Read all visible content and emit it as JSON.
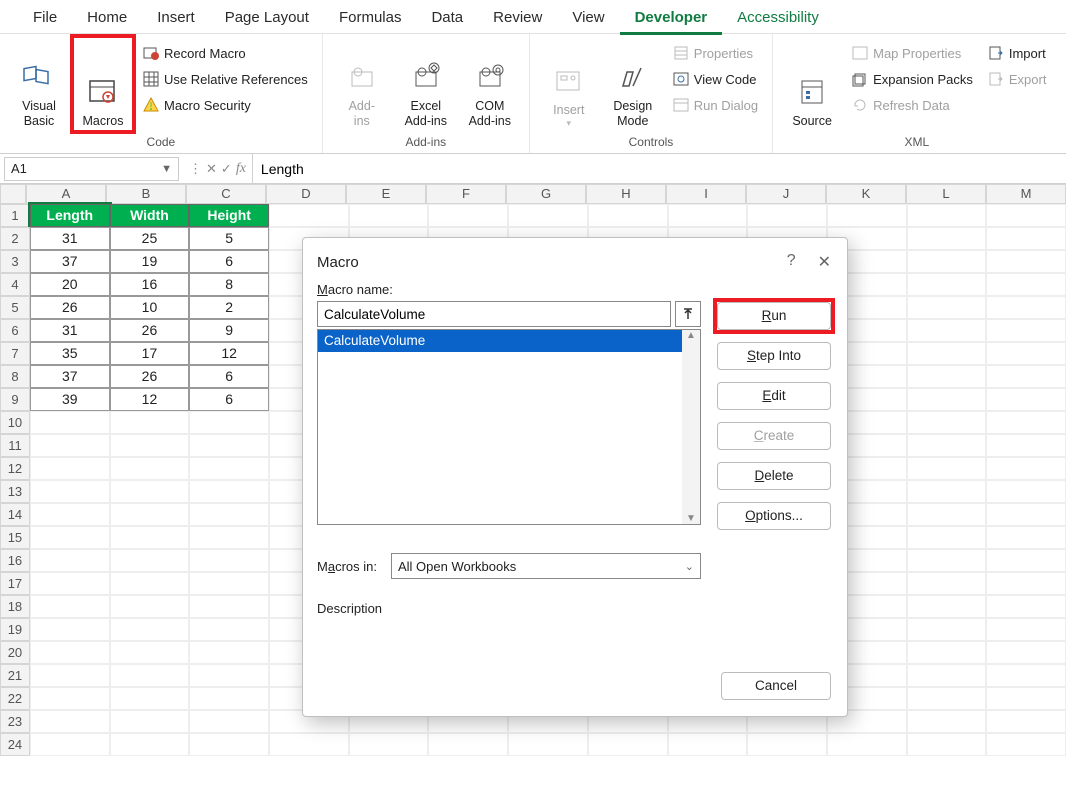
{
  "ribbon_tabs": {
    "file": "File",
    "home": "Home",
    "insert": "Insert",
    "pagelayout": "Page Layout",
    "formulas": "Formulas",
    "data": "Data",
    "review": "Review",
    "view": "View",
    "developer": "Developer",
    "accessibility": "Accessibility"
  },
  "ribbon": {
    "visual_basic": "Visual\nBasic",
    "macros": "Macros",
    "record_macro": "Record Macro",
    "use_rel_refs": "Use Relative References",
    "macro_security": "Macro Security",
    "group_code": "Code",
    "addins": "Add-\nins",
    "excel_addins": "Excel\nAdd-ins",
    "com_addins": "COM\nAdd-ins",
    "group_addins": "Add-ins",
    "insert": "Insert",
    "design_mode": "Design\nMode",
    "properties": "Properties",
    "view_code": "View Code",
    "run_dialog": "Run Dialog",
    "group_controls": "Controls",
    "source": "Source",
    "map_properties": "Map Properties",
    "expansion_packs": "Expansion Packs",
    "refresh_data": "Refresh Data",
    "import": "Import",
    "export": "Export",
    "group_xml": "XML"
  },
  "formula_bar": {
    "name_box": "A1",
    "formula": "Length"
  },
  "columns": [
    "A",
    "B",
    "C",
    "D",
    "E",
    "F",
    "G",
    "H",
    "I",
    "J",
    "K",
    "L",
    "M"
  ],
  "table": {
    "headers": [
      "Length",
      "Width",
      "Height"
    ],
    "rows": [
      [
        "31",
        "25",
        "5"
      ],
      [
        "37",
        "19",
        "6"
      ],
      [
        "20",
        "16",
        "8"
      ],
      [
        "26",
        "10",
        "2"
      ],
      [
        "31",
        "26",
        "9"
      ],
      [
        "35",
        "17",
        "12"
      ],
      [
        "37",
        "26",
        "6"
      ],
      [
        "39",
        "12",
        "6"
      ]
    ]
  },
  "row_count": 24,
  "dialog": {
    "title": "Macro",
    "macro_name_label": "Macro name:",
    "macro_name_value": "CalculateVolume",
    "macro_list_item": "CalculateVolume",
    "macros_in_label": "Macros in:",
    "macros_in_value": "All Open Workbooks",
    "description_label": "Description",
    "run": "Run",
    "step_into": "Step Into",
    "edit": "Edit",
    "create": "Create",
    "delete": "Delete",
    "options": "Options...",
    "cancel": "Cancel"
  }
}
